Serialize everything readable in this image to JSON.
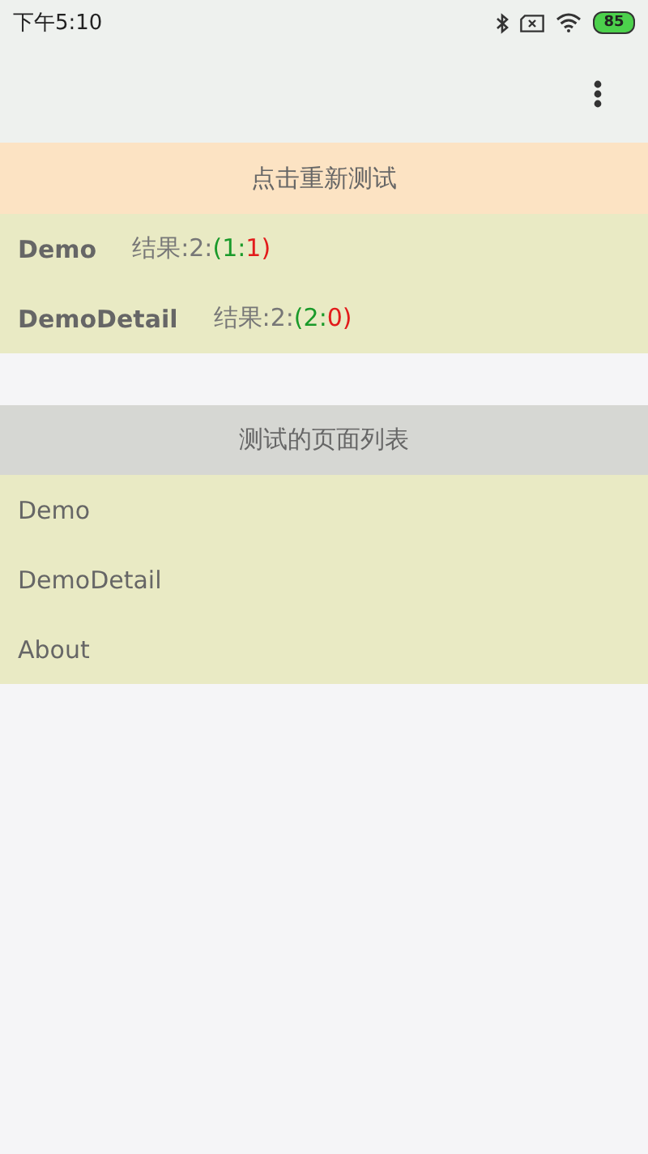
{
  "status_bar": {
    "time": "下午5:10",
    "battery": "85"
  },
  "retest_button": {
    "label": "点击重新测试"
  },
  "results": [
    {
      "name": "Demo",
      "parts": [
        {
          "kind": "plain",
          "text": "结果:2:"
        },
        {
          "kind": "pass",
          "text": "(1:"
        },
        {
          "kind": "fail",
          "text": "1)"
        }
      ]
    },
    {
      "name": "DemoDetail",
      "parts": [
        {
          "kind": "plain",
          "text": "结果:2:"
        },
        {
          "kind": "pass",
          "text": "(2:"
        },
        {
          "kind": "fail",
          "text": "0)"
        }
      ]
    }
  ],
  "page_list": {
    "title": "测试的页面列表",
    "items": [
      "Demo",
      "DemoDetail",
      "About"
    ]
  }
}
